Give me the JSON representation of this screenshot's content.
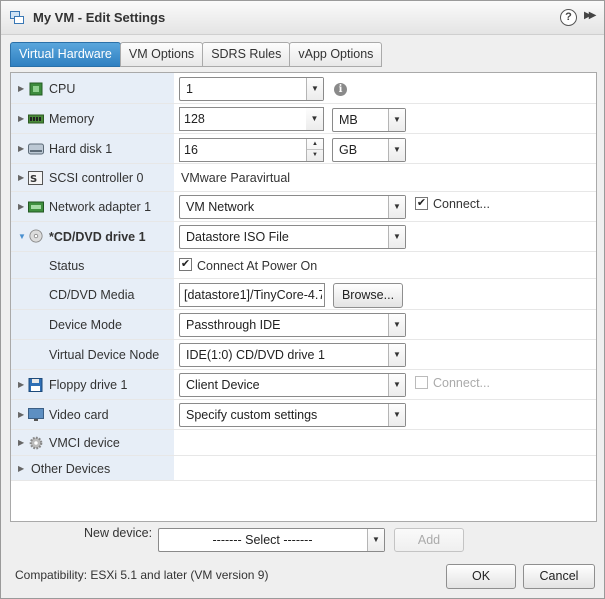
{
  "window": {
    "title": "My VM - Edit Settings"
  },
  "header_icons": {
    "help": "?",
    "more": "▶▶"
  },
  "tabs": [
    {
      "label": "Virtual Hardware"
    },
    {
      "label": "VM Options"
    },
    {
      "label": "SDRS Rules"
    },
    {
      "label": "vApp Options"
    }
  ],
  "hardware": {
    "cpu": {
      "label": "CPU",
      "value": "1"
    },
    "memory": {
      "label": "Memory",
      "value": "128",
      "unit": "MB"
    },
    "hard_disk": {
      "label": "Hard disk 1",
      "value": "16",
      "unit": "GB"
    },
    "scsi": {
      "label": "SCSI controller 0",
      "value": "VMware Paravirtual"
    },
    "network": {
      "label": "Network adapter 1",
      "value": "VM Network",
      "connect_label": "Connect...",
      "connect_checked": "✔"
    },
    "cddvd": {
      "label": "*CD/DVD drive 1",
      "value": "Datastore ISO File",
      "status_label": "Status",
      "status_checkbox": "✔",
      "status_value": "Connect At Power On",
      "media_label": "CD/DVD Media",
      "media_value": "[datastore1]/TinyCore-4.7.",
      "browse_label": "Browse...",
      "mode_label": "Device Mode",
      "mode_value": "Passthrough IDE",
      "node_label": "Virtual Device Node",
      "node_value": "IDE(1:0) CD/DVD drive 1"
    },
    "floppy": {
      "label": "Floppy drive 1",
      "value": "Client Device",
      "connect_label": "Connect..."
    },
    "video": {
      "label": "Video card",
      "value": "Specify custom settings"
    },
    "vmci": {
      "label": "VMCI device"
    },
    "other": {
      "label": "Other Devices"
    }
  },
  "new_device": {
    "label": "New device:",
    "select_value": "------- Select -------",
    "add_label": "Add"
  },
  "footer": {
    "compatibility": "Compatibility: ESXi 5.1 and later (VM version 9)",
    "ok_label": "OK",
    "cancel_label": "Cancel"
  },
  "colors": {
    "accent": "#2f80c1",
    "label_bg": "#e7eef7"
  }
}
